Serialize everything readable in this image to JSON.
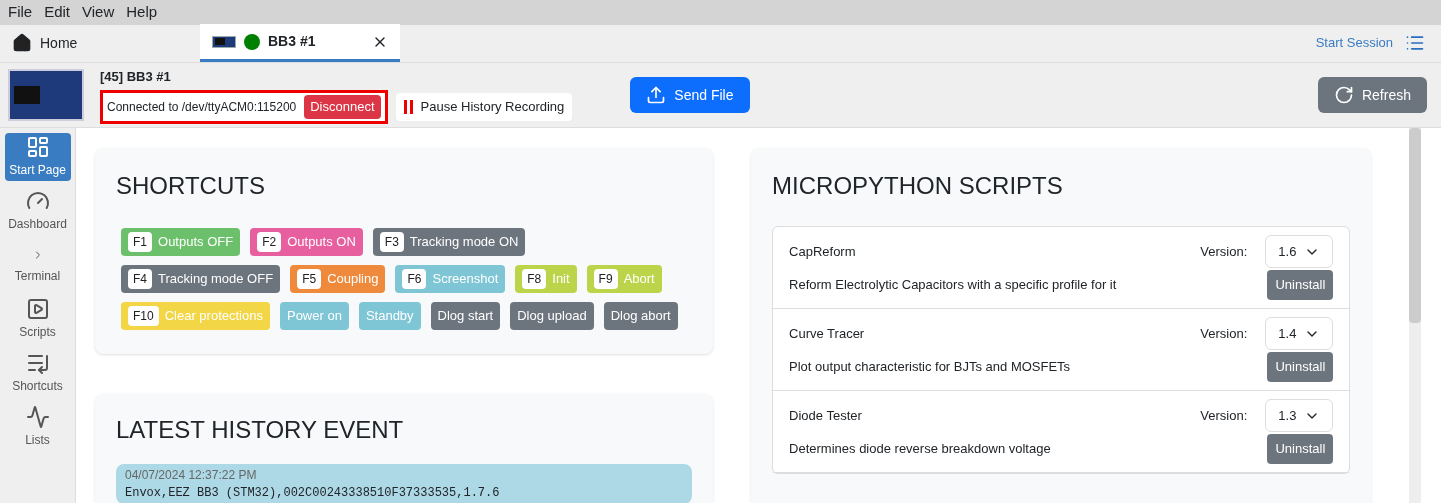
{
  "menu": [
    "File",
    "Edit",
    "View",
    "Help"
  ],
  "tabs": [
    {
      "label": "Home",
      "kind": "home",
      "selected": false
    },
    {
      "label": "BB3 #1",
      "kind": "instrument",
      "selected": true,
      "color": "#008000",
      "closable": true
    }
  ],
  "session": {
    "label": "Start Session"
  },
  "header": {
    "title": "[45] BB3 #1",
    "connection": "Connected to /dev/ttyACM0:115200",
    "disconnect": "Disconnect",
    "pause": "Pause History Recording",
    "send_file": "Send File",
    "refresh": "Refresh"
  },
  "sidebar": {
    "items": [
      {
        "label": "Start Page",
        "selected": true
      },
      {
        "label": "Dashboard",
        "selected": false
      },
      {
        "label": "Terminal",
        "selected": false
      },
      {
        "label": "Scripts",
        "selected": false
      },
      {
        "label": "Shortcuts",
        "selected": false
      },
      {
        "label": "Lists",
        "selected": false
      }
    ]
  },
  "shortcuts": {
    "title": "SHORTCUTS",
    "items": [
      {
        "key": "F1",
        "label": "Outputs OFF",
        "color": "#6cc06c"
      },
      {
        "key": "F2",
        "label": "Outputs ON",
        "color": "#e85fa0"
      },
      {
        "key": "F3",
        "label": "Tracking mode ON",
        "color": "#6c757d"
      },
      {
        "key": "F4",
        "label": "Tracking mode OFF",
        "color": "#6c757d"
      },
      {
        "key": "F5",
        "label": "Coupling",
        "color": "#ef8a3c"
      },
      {
        "key": "F6",
        "label": "Screenshot",
        "color": "#7ec5d6"
      },
      {
        "key": "F8",
        "label": "Init",
        "color": "#bcd44a"
      },
      {
        "key": "F9",
        "label": "Abort",
        "color": "#bcd44a"
      },
      {
        "key": "F10",
        "label": "Clear protections",
        "color": "#f2d645"
      },
      {
        "label": "Power on",
        "color": "#7ec5d6"
      },
      {
        "label": "Standby",
        "color": "#7ec5d6"
      },
      {
        "label": "Dlog start",
        "color": "#6c757d"
      },
      {
        "label": "Dlog upload",
        "color": "#6c757d"
      },
      {
        "label": "Dlog abort",
        "color": "#6c757d"
      }
    ]
  },
  "history": {
    "title": "LATEST HISTORY EVENT",
    "event": {
      "time": "04/07/2024 12:37:22 PM",
      "text": "Envox,EEZ BB3 (STM32),002C00243338510F37333535,1.7.6"
    }
  },
  "scripts": {
    "title": "MICROPYTHON SCRIPTS",
    "items": [
      {
        "name": "CapReform",
        "version_label": "Version:",
        "version": "1.6",
        "description": "Reform Electrolytic Capacitors with a specific profile for it",
        "action": "Uninstall"
      },
      {
        "name": "Curve Tracer",
        "version_label": "Version:",
        "version": "1.4",
        "description": "Plot output characteristic for BJTs and MOSFETs",
        "action": "Uninstall"
      },
      {
        "name": "Diode Tester",
        "version_label": "Version:",
        "version": "1.3",
        "description": "Determines diode reverse breakdown voltage",
        "action": "Uninstall"
      }
    ]
  }
}
